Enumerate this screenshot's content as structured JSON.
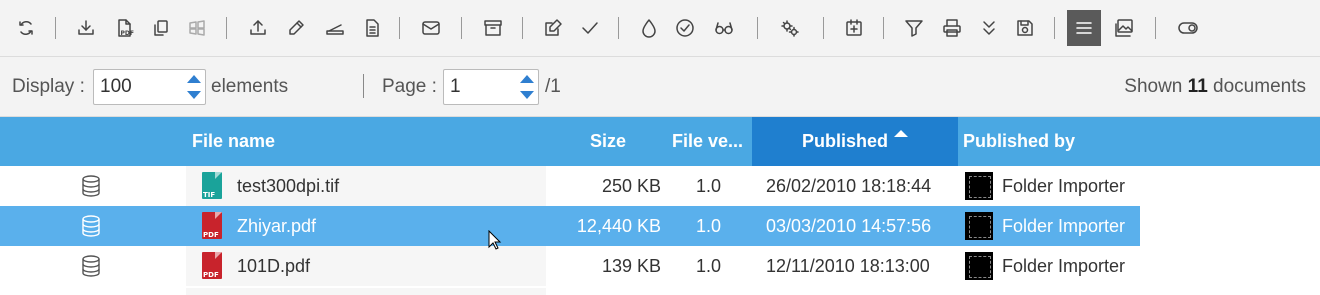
{
  "paging": {
    "display_label": "Display :",
    "display_value": "100",
    "elements_label": "elements",
    "page_label": "Page :",
    "page_value": "1",
    "page_total": "/1",
    "shown_prefix": "Shown",
    "shown_count": "11",
    "shown_suffix": "documents"
  },
  "columns": {
    "file_name": "File name",
    "size": "Size",
    "file_version": "File ve...",
    "published": "Published",
    "published_by": "Published by"
  },
  "rows": [
    {
      "file_name": "test300dpi.tif",
      "type": "TIF",
      "icon_color": "#1aa39a",
      "size": "250 KB",
      "version": "1.0",
      "published": "26/02/2010 18:18:44",
      "published_by": "Folder Importer"
    },
    {
      "file_name": "Zhiyar.pdf",
      "type": "PDF",
      "icon_color": "#c8232c",
      "size": "12,440 KB",
      "version": "1.0",
      "published": "03/03/2010 14:57:56",
      "published_by": "Folder Importer"
    },
    {
      "file_name": "101D.pdf",
      "type": "PDF",
      "icon_color": "#c8232c",
      "size": "139 KB",
      "version": "1.0",
      "published": "12/11/2010 18:13:00",
      "published_by": "Folder Importer"
    }
  ],
  "selected_row": 1,
  "colors": {
    "header": "#4aa8e3",
    "sorted_header": "#1f7fcf",
    "selected_row": "#5ab0ec",
    "toolbar_bg": "#f3f3f3"
  },
  "toolbar_icons": [
    "refresh-icon",
    "download-icon",
    "pdf-download-icon",
    "copy-icon",
    "windows-icon",
    "upload-icon",
    "pen-icon",
    "scanner-icon",
    "document-icon",
    "mail-icon",
    "archive-icon",
    "edit-icon",
    "check-icon",
    "drop-icon",
    "check-circle-icon",
    "glasses-icon",
    "gears-icon",
    "add-calendar-icon",
    "filter-icon",
    "print-icon",
    "chevron-double-down-icon",
    "save-icon",
    "list-view-icon",
    "gallery-view-icon",
    "toggle-icon"
  ]
}
